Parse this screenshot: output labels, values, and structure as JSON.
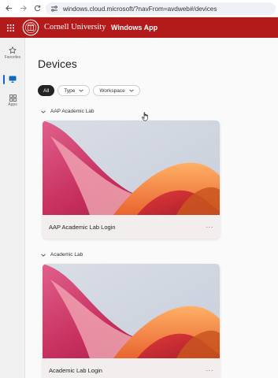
{
  "browser": {
    "url": "windows.cloud.microsoft/?navFrom=avdweb#/devices"
  },
  "header": {
    "university": "Cornell University",
    "app_name": "Windows App"
  },
  "rail": {
    "items": [
      {
        "label": "Favorites",
        "icon": "star-icon"
      },
      {
        "label": "",
        "icon": "monitor-icon"
      },
      {
        "label": "Apps",
        "icon": "apps-grid-icon"
      }
    ]
  },
  "main": {
    "title": "Devices",
    "filters": [
      {
        "label": "All",
        "selected": true
      },
      {
        "label": "Type"
      },
      {
        "label": "Workspace"
      }
    ],
    "sections": [
      {
        "label": "AAP Academic Lab",
        "card_title": "AAP Academic Lab Login"
      },
      {
        "label": "Academic Lab",
        "card_title": "Academic Lab Login"
      }
    ]
  },
  "colors": {
    "brand": "#b31b1b",
    "accent": "#0f6cbd"
  }
}
